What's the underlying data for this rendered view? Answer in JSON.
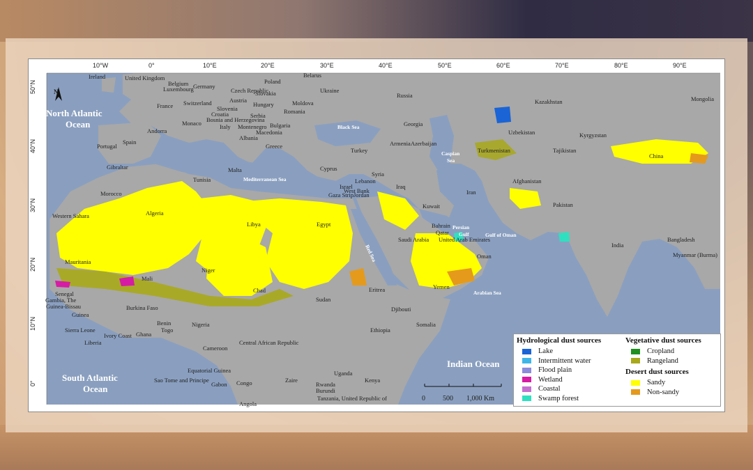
{
  "map": {
    "longitude_labels": [
      "10°W",
      "0°",
      "10°E",
      "20°E",
      "30°E",
      "40°E",
      "50°E",
      "60°E",
      "70°E",
      "80°E",
      "90°E"
    ],
    "latitude_labels": [
      "50°N",
      "40°N",
      "30°N",
      "20°N",
      "10°N",
      "0°"
    ],
    "oceans": [
      "North Atlantic",
      "Ocean",
      "South Atlantic",
      "Ocean",
      "Indian Ocean"
    ],
    "seas": [
      "Mediterranean Sea",
      "Black Sea",
      "Caspian",
      "Sea",
      "Red Sea",
      "Persian",
      "Gulf",
      "Gulf of Oman",
      "Arabian Sea"
    ],
    "countries": [
      "Ireland",
      "United Kingdom",
      "Belgium",
      "Luxembourg",
      "Germany",
      "Poland",
      "Belarus",
      "Ukraine",
      "Russia",
      "Kazakhstan",
      "Mongolia",
      "France",
      "Switzerland",
      "Czech Republic",
      "Slovakia",
      "Austria",
      "Hungary",
      "Moldova",
      "Slovenia",
      "Romania",
      "Croatia",
      "Serbia",
      "Bosnia and Herzegovina",
      "Italy",
      "Monaco",
      "Montenegro",
      "Bulgaria",
      "Andorra",
      "Macedonia",
      "Albania",
      "Greece",
      "Portugal",
      "Spain",
      "Gibraltar",
      "Turkey",
      "Georgia",
      "Armenia",
      "Azerbaijan",
      "Uzbekistan",
      "Kyrgyzstan",
      "Tajikistan",
      "Turkmenistan",
      "China",
      "Malta",
      "Tunisia",
      "Cyprus",
      "Lebanon",
      "Syria",
      "Israel",
      "West Bank",
      "Gaza Strip",
      "Jordan",
      "Iraq",
      "Iran",
      "Afghanistan",
      "Morocco",
      "Algeria",
      "Libya",
      "Egypt",
      "Kuwait",
      "Pakistan",
      "Bahrain",
      "Qatar",
      "United Arab Emirates",
      "Western Sahara",
      "Saudi Arabia",
      "India",
      "Mauritania",
      "Oman",
      "Bangladesh",
      "Myanmar (Burma)",
      "Mali",
      "Niger",
      "Chad",
      "Sudan",
      "Eritrea",
      "Yemen",
      "Senegal",
      "Gambia, The",
      "Guinea-Bissau",
      "Burkina Faso",
      "Djibouti",
      "Guinea",
      "Benin",
      "Nigeria",
      "Ethiopia",
      "Sierra Leone",
      "Togo",
      "Somalia",
      "Liberia",
      "Ivory Coast",
      "Ghana",
      "Cameroon",
      "Central African Republic",
      "Uganda",
      "Kenya",
      "Equatorial Guinea",
      "Sao Tome and Principe",
      "Gabon",
      "Congo",
      "Zaire",
      "Rwanda",
      "Burundi",
      "Tanzania, United Republic of",
      "Angola"
    ],
    "north_arrow": "N",
    "scale_bar": {
      "labels": [
        "0",
        "500",
        "1,000 Km"
      ]
    }
  },
  "legend": {
    "hydrological": {
      "title": "Hydrological dust sources",
      "items": [
        {
          "label": "Lake",
          "color": "#1a64d6"
        },
        {
          "label": "Intermittent water",
          "color": "#3fb6e8"
        },
        {
          "label": "Flood plain",
          "color": "#8c8cdc"
        },
        {
          "label": "Wetland",
          "color": "#d61ca4"
        },
        {
          "label": "Coastal",
          "color": "#c56fd0"
        },
        {
          "label": "Swamp forest",
          "color": "#2fe0c0"
        }
      ]
    },
    "vegetative": {
      "title": "Vegetative dust sources",
      "items": [
        {
          "label": "Cropland",
          "color": "#1f8f1f"
        },
        {
          "label": "Rangeland",
          "color": "#a8a81a"
        }
      ]
    },
    "desert": {
      "title": "Desert dust sources",
      "items": [
        {
          "label": "Sandy",
          "color": "#ffff00"
        },
        {
          "label": "Non-sandy",
          "color": "#e59a1c"
        }
      ]
    }
  },
  "colors": {
    "water": "#8a9fbf",
    "land": "#a9a9a9",
    "sandy": "#ffff00",
    "non_sandy": "#e59a1c",
    "rangeland": "#a8a81a"
  }
}
